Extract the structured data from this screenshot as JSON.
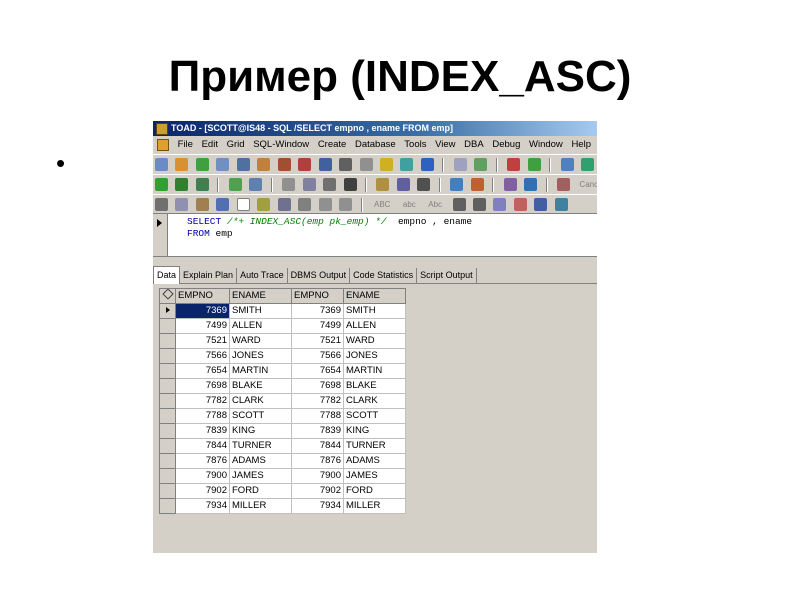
{
  "slide": {
    "title": "Пример (INDEX_ASC)",
    "bullet": "•"
  },
  "window": {
    "title": "TOAD - [SCOTT@IS48 - SQL /SELECT  empno , ename  FROM emp]",
    "menu": [
      "File",
      "Edit",
      "Grid",
      "SQL-Window",
      "Create",
      "Database",
      "Tools",
      "View",
      "DBA",
      "Debug",
      "Window",
      "Help"
    ],
    "toolbar3_text": [
      "ABC",
      "abc",
      "Abc"
    ],
    "cancel_label": "Cancel"
  },
  "editor": {
    "line1_kw": "SELECT",
    "line1_hint": "/*+ INDEX_ASC(emp pk_emp) */",
    "line1_cols": "empno , ename",
    "line2_kw": "FROM",
    "line2_table": "emp"
  },
  "tabs": [
    "Data",
    "Explain Plan",
    "Auto Trace",
    "DBMS Output",
    "Code Statistics",
    "Script Output"
  ],
  "grid": {
    "columns": [
      "EMPNO",
      "ENAME",
      "EMPNO",
      "ENAME"
    ],
    "rows": [
      [
        "7369",
        "SMITH",
        "7369",
        "SMITH"
      ],
      [
        "7499",
        "ALLEN",
        "7499",
        "ALLEN"
      ],
      [
        "7521",
        "WARD",
        "7521",
        "WARD"
      ],
      [
        "7566",
        "JONES",
        "7566",
        "JONES"
      ],
      [
        "7654",
        "MARTIN",
        "7654",
        "MARTIN"
      ],
      [
        "7698",
        "BLAKE",
        "7698",
        "BLAKE"
      ],
      [
        "7782",
        "CLARK",
        "7782",
        "CLARK"
      ],
      [
        "7788",
        "SCOTT",
        "7788",
        "SCOTT"
      ],
      [
        "7839",
        "KING",
        "7839",
        "KING"
      ],
      [
        "7844",
        "TURNER",
        "7844",
        "TURNER"
      ],
      [
        "7876",
        "ADAMS",
        "7876",
        "ADAMS"
      ],
      [
        "7900",
        "JAMES",
        "7900",
        "JAMES"
      ],
      [
        "7902",
        "FORD",
        "7902",
        "FORD"
      ],
      [
        "7934",
        "MILLER",
        "7934",
        "MILLER"
      ]
    ]
  }
}
